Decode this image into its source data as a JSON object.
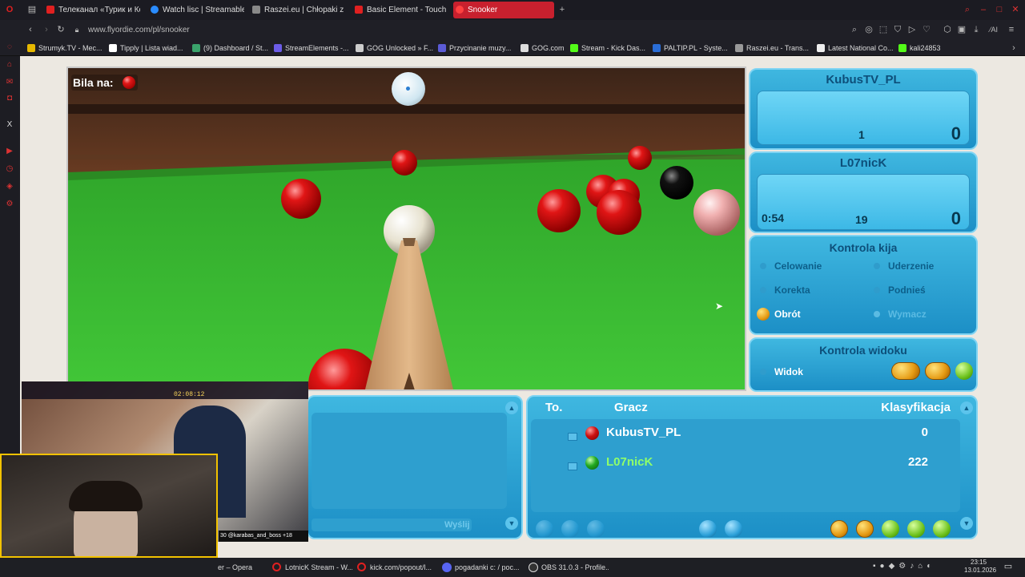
{
  "browser": {
    "tabs": [
      {
        "label": "Телеканал «Турик и Кон...",
        "color": "#e02020"
      },
      {
        "label": "Watch lisc | Streamable",
        "color": "#2a8cff"
      },
      {
        "label": "Raszei.eu | Chłopaki z Ra...",
        "color": "#dddddd"
      },
      {
        "label": "Basic Element - Touch",
        "color": "#e02020"
      },
      {
        "label": "Snooker",
        "color": "#e02020"
      }
    ],
    "url": "www.flyordie.com/pl/snooker",
    "bookmarks": [
      "Strumyk.TV - Mec...",
      "Tipply | Lista wiad...",
      "(9) Dashboard / St...",
      "StreamElements -...",
      "GOG Unlocked » F...",
      "Przycinanie muzy...",
      "GOG.com",
      "Stream - Kick Das...",
      "PALTIP.PL - Syste...",
      "Raszei.eu - Trans...",
      "Latest National Co...",
      "kali24853"
    ]
  },
  "game": {
    "ball_on_label": "Bila na:",
    "player1": {
      "name": "KubusTV_PL",
      "break": "1",
      "score": "0"
    },
    "player2": {
      "name": "L07nicK",
      "timer": "0:54",
      "break": "19",
      "score": "0"
    },
    "cue_control": {
      "title": "Kontrola kija",
      "options": [
        "Celowanie",
        "Uderzenie",
        "Korekta",
        "Podnieś",
        "Obrót",
        "Wymacz"
      ]
    },
    "view_control": {
      "title": "Kontrola widoku",
      "option": "Widok"
    },
    "chat": {
      "send_label": "Wyślij"
    },
    "ranking": {
      "headers": [
        "To.",
        "Gracz",
        "Klasyfikacja"
      ],
      "rows": [
        {
          "name": "KubusTV_PL",
          "rating": "0",
          "ball_color": "#cc1111"
        },
        {
          "name": "L07nicK",
          "rating": "222",
          "ball_color": "#22aa22"
        }
      ]
    }
  },
  "webcam": {
    "timer": "02:08:12",
    "footer_count": "30",
    "footer_user": "@karabas_and_boss",
    "footer_plus": "+18"
  },
  "taskbar": {
    "items": [
      "er – Opera",
      "LotnicK Stream - W...",
      "kick.com/popout/l...",
      "pogadanki c: / poc...",
      "OBS 31.0.3 - Profile..."
    ],
    "time": "23:15",
    "date": "13.01.2026"
  }
}
